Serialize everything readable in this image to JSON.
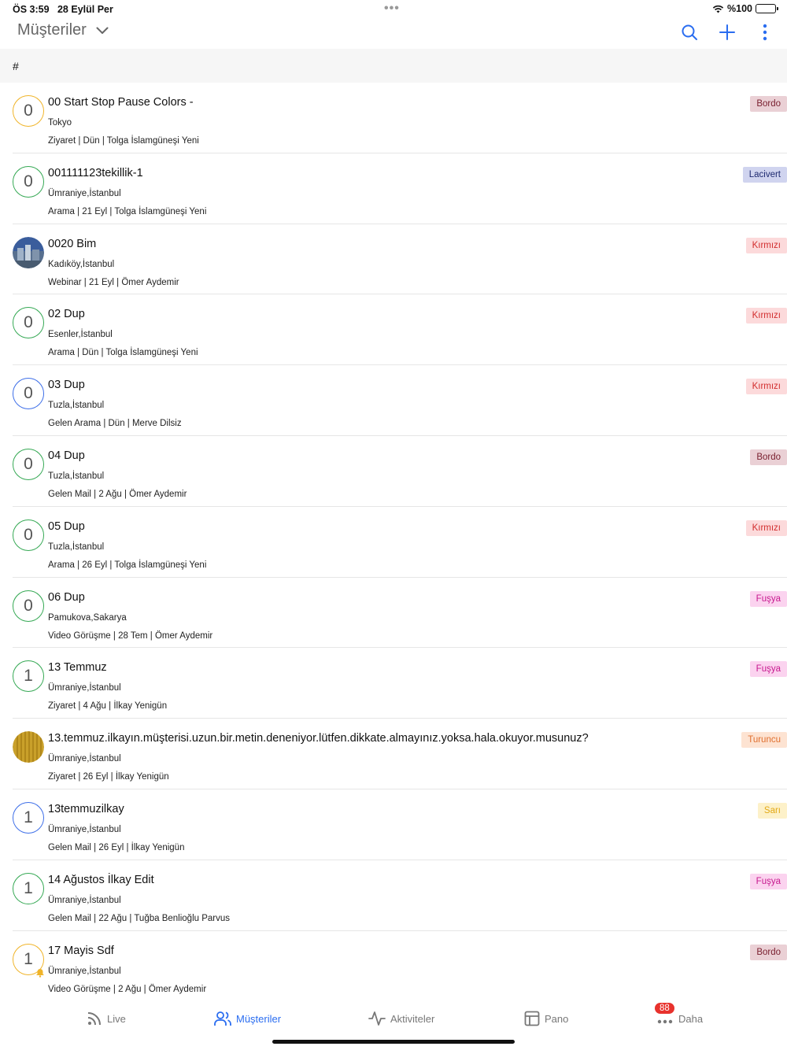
{
  "status_bar": {
    "time": "ÖS 3:59",
    "date": "28 Eylül Per",
    "battery": "%100"
  },
  "header": {
    "title": "Müşteriler",
    "icons": [
      "chevron-down-icon",
      "search-icon",
      "plus-icon",
      "more-vertical-icon"
    ]
  },
  "section": {
    "label": "#"
  },
  "colors": {
    "accent": "#2a6df0",
    "ring_yellow": "#f0b429",
    "ring_green": "#34a853",
    "ring_blue": "#3d6ee8"
  },
  "customers": [
    {
      "initial": "0",
      "name": "00 Start Stop Pause Colors -",
      "city": "Tokyo",
      "meta": "Ziyaret | Dün | Tolga İslamgüneşi Yeni",
      "tag": "Bordo",
      "tag_bg": "#ead0d5",
      "tag_fg": "#7a2030",
      "ring": "#f0b429"
    },
    {
      "initial": "0",
      "name": "001111123tekillik-1",
      "city": "Ümraniye,İstanbul",
      "meta": "Arama | 21 Eyl | Tolga İslamgüneşi Yeni",
      "tag": "Lacivert",
      "tag_bg": "#d0d4ef",
      "tag_fg": "#1e2a70",
      "ring": "#34a853"
    },
    {
      "initial": "",
      "name": "0020 Bim",
      "city": "Kadıköy,İstanbul",
      "meta": "Webinar | 21 Eyl | Ömer Aydemir",
      "tag": "Kırmızı",
      "tag_bg": "#fcdadb",
      "tag_fg": "#d22f2f",
      "ring": "#3d6ee8",
      "photo": "city"
    },
    {
      "initial": "0",
      "name": "02 Dup",
      "city": "Esenler,İstanbul",
      "meta": "Arama | Dün | Tolga İslamgüneşi Yeni",
      "tag": "Kırmızı",
      "tag_bg": "#fcdadb",
      "tag_fg": "#d22f2f",
      "ring": "#34a853"
    },
    {
      "initial": "0",
      "name": "03 Dup",
      "city": "Tuzla,İstanbul",
      "meta": "Gelen Arama | Dün | Merve Dilsiz",
      "tag": "Kırmızı",
      "tag_bg": "#fcdadb",
      "tag_fg": "#d22f2f",
      "ring": "#3d6ee8"
    },
    {
      "initial": "0",
      "name": "04 Dup",
      "city": "Tuzla,İstanbul",
      "meta": "Gelen Mail | 2 Ağu | Ömer Aydemir",
      "tag": "Bordo",
      "tag_bg": "#ead0d5",
      "tag_fg": "#7a2030",
      "ring": "#34a853"
    },
    {
      "initial": "0",
      "name": "05 Dup",
      "city": "Tuzla,İstanbul",
      "meta": "Arama | 26 Eyl | Tolga İslamgüneşi Yeni",
      "tag": "Kırmızı",
      "tag_bg": "#fcdadb",
      "tag_fg": "#d22f2f",
      "ring": "#34a853"
    },
    {
      "initial": "0",
      "name": "06 Dup",
      "city": "Pamukova,Sakarya",
      "meta": "Video Görüşme | 28 Tem | Ömer Aydemir",
      "tag": "Fuşya",
      "tag_bg": "#fbd3ef",
      "tag_fg": "#c7198f",
      "ring": "#34a853"
    },
    {
      "initial": "1",
      "name": "13 Temmuz",
      "city": "Ümraniye,İstanbul",
      "meta": "Ziyaret | 4 Ağu | İlkay Yenigün",
      "tag": "Fuşya",
      "tag_bg": "#fbd3ef",
      "tag_fg": "#c7198f",
      "ring": "#34a853"
    },
    {
      "initial": "",
      "name": "13.temmuz.ilkayın.müşterisi.uzun.bir.metin.deneniyor.lütfen.dikkate.almayınız.yoksa.hala.okuyor.musunuz?",
      "city": "Ümraniye,İstanbul",
      "meta": "Ziyaret | 26 Eyl | İlkay Yenigün",
      "tag": "Turuncu",
      "tag_bg": "#fde3d2",
      "tag_fg": "#e07030",
      "ring": "#3d6ee8",
      "photo": "wood"
    },
    {
      "initial": "1",
      "name": "13temmuzilkay",
      "city": "Ümraniye,İstanbul",
      "meta": "Gelen Mail | 26 Eyl | İlkay Yenigün",
      "tag": "Sarı",
      "tag_bg": "#fdf1c9",
      "tag_fg": "#e2a917",
      "ring": "#3d6ee8"
    },
    {
      "initial": "1",
      "name": "14 Ağustos İlkay Edit",
      "city": "Ümraniye,İstanbul",
      "meta": "Gelen Mail | 22 Ağu | Tuğba Benlioğlu Parvus",
      "tag": "Fuşya",
      "tag_bg": "#fbd3ef",
      "tag_fg": "#c7198f",
      "ring": "#34a853"
    },
    {
      "initial": "1",
      "name": "17 Mayis Sdf",
      "city": "Ümraniye,İstanbul",
      "meta": "Video Görüşme | 2 Ağu | Ömer Aydemir",
      "tag": "Bordo",
      "tag_bg": "#ead0d5",
      "tag_fg": "#7a2030",
      "ring": "#f0b429",
      "bell": true
    }
  ],
  "tabs": [
    {
      "label": "Live",
      "icon": "rss-icon"
    },
    {
      "label": "Müşteriler",
      "icon": "users-icon",
      "active": true
    },
    {
      "label": "Aktiviteler",
      "icon": "activity-icon"
    },
    {
      "label": "Pano",
      "icon": "layout-icon"
    },
    {
      "label": "Daha",
      "icon": "more-icon",
      "badge": "88"
    }
  ]
}
